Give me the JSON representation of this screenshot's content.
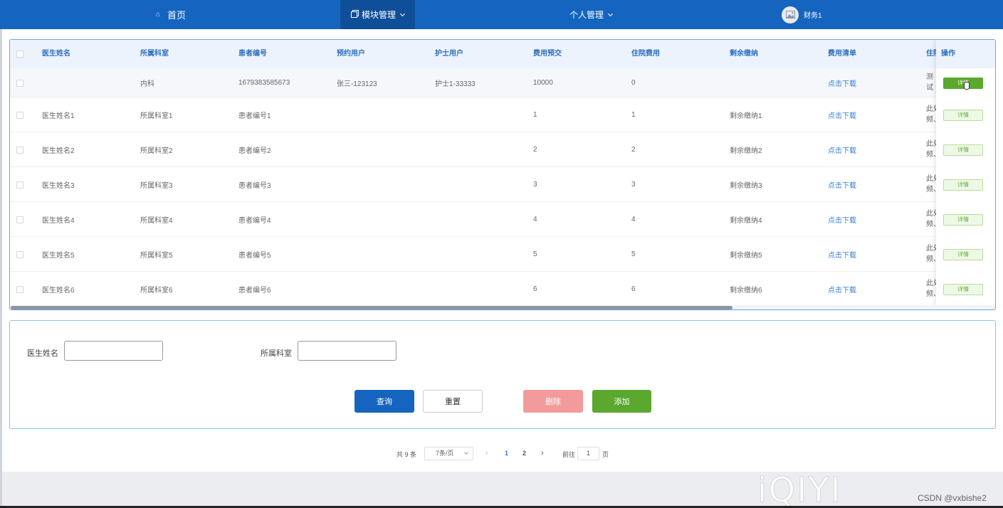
{
  "nav": {
    "home": "首页",
    "module": "模块管理",
    "personal": "个人管理",
    "user": "财务1"
  },
  "table": {
    "headers": [
      "医生姓名",
      "所属科室",
      "患者编号",
      "预约用户",
      "护士用户",
      "费用预交",
      "住院费用",
      "剩余缴纳",
      "费用清单",
      "住院"
    ],
    "op_header": "操作",
    "rows": [
      {
        "doctor": "",
        "dept": "内科",
        "patient": "1679383585673",
        "user": "张三-123123",
        "nurse": "护士1-33333",
        "prepaid": "10000",
        "fee": "0",
        "remain": "",
        "list": "点击下载",
        "hosp": "测试"
      },
      {
        "doctor": "医生姓名1",
        "dept": "所属科室1",
        "patient": "患者编号1",
        "user": "",
        "nurse": "",
        "prepaid": "1",
        "fee": "1",
        "remain": "剩余缴纳1",
        "list": "点击下载",
        "hosp": "此处\n频、"
      },
      {
        "doctor": "医生姓名2",
        "dept": "所属科室2",
        "patient": "患者编号2",
        "user": "",
        "nurse": "",
        "prepaid": "2",
        "fee": "2",
        "remain": "剩余缴纳2",
        "list": "点击下载",
        "hosp": "此处\n频、"
      },
      {
        "doctor": "医生姓名3",
        "dept": "所属科室3",
        "patient": "患者编号3",
        "user": "",
        "nurse": "",
        "prepaid": "3",
        "fee": "3",
        "remain": "剩余缴纳3",
        "list": "点击下载",
        "hosp": "此处\n频、"
      },
      {
        "doctor": "医生姓名4",
        "dept": "所属科室4",
        "patient": "患者编号4",
        "user": "",
        "nurse": "",
        "prepaid": "4",
        "fee": "4",
        "remain": "剩余缴纳4",
        "list": "点击下载",
        "hosp": "此处\n频、"
      },
      {
        "doctor": "医生姓名5",
        "dept": "所属科室5",
        "patient": "患者编号5",
        "user": "",
        "nurse": "",
        "prepaid": "5",
        "fee": "5",
        "remain": "剩余缴纳5",
        "list": "点击下载",
        "hosp": "此处\n频、"
      },
      {
        "doctor": "医生姓名6",
        "dept": "所属科室6",
        "patient": "患者编号6",
        "user": "",
        "nurse": "",
        "prepaid": "6",
        "fee": "6",
        "remain": "剩余缴纳6",
        "list": "点击下载",
        "hosp": "此处\n频、"
      }
    ],
    "detail_label": "详情"
  },
  "search": {
    "doctor_label": "医生姓名",
    "doctor_value": "",
    "dept_label": "所属科室",
    "dept_value": "",
    "query": "查询",
    "reset": "重置",
    "delete": "删除",
    "add": "添加"
  },
  "pager": {
    "total": "共 9 条",
    "page_size": "7条/页",
    "pages": [
      "1",
      "2"
    ],
    "current": "1",
    "goto": "前往",
    "goto_value": "1",
    "page_suffix": "页"
  },
  "footer": {
    "watermark": "iQIYI",
    "credit": "CSDN @vxbishe2"
  },
  "colors": {
    "navbar": "#1565c0",
    "primary": "#1565c0",
    "danger": "#f39b9b",
    "success": "#5aa82e",
    "link": "#3a7fd0"
  }
}
